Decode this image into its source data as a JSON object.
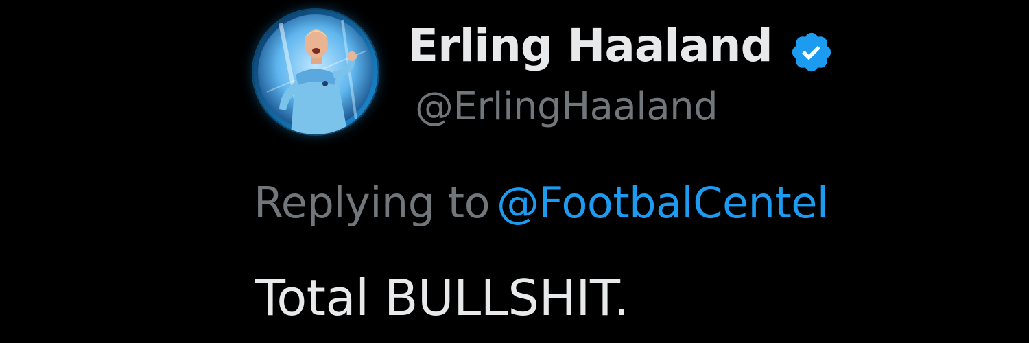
{
  "tweet": {
    "author": {
      "display_name": "Erling Haaland",
      "handle": "@ErlingHaaland",
      "verified": true,
      "avatar_icon": "player-photo"
    },
    "reply": {
      "prefix": "Replying to",
      "mention": "@FootbalCentel"
    },
    "text": "Total BULLSHIT."
  },
  "colors": {
    "background": "#000000",
    "primary_text": "#e7e9ea",
    "secondary_text": "#71767b",
    "accent": "#1d9bf0"
  }
}
